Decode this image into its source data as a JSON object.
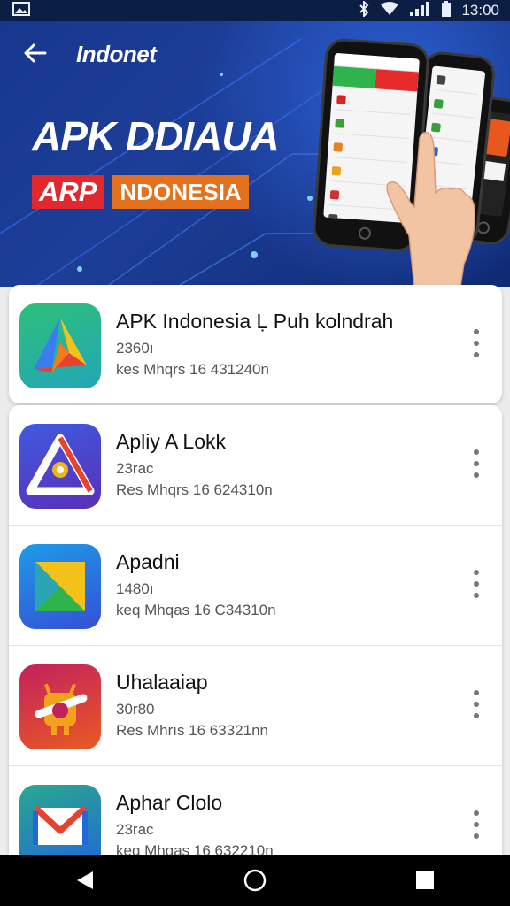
{
  "status_bar": {
    "time": "13:00",
    "icons": [
      "image-icon",
      "bluetooth-icon",
      "wifi-icon",
      "signal-icon",
      "battery-icon"
    ]
  },
  "header": {
    "back_icon": "arrow-left-icon",
    "title": "Indonet",
    "headline": "APK DDIAUA",
    "tag_red": "ARP",
    "tag_orange": "NDONESIA"
  },
  "apps": [
    {
      "name": "APK Indonesia Ḷ Puh kolndrah",
      "version": "2360ı",
      "meta": "kes Mhqrs 16 431240n",
      "icon": "drive-triangle-icon"
    },
    {
      "name": "Apliy A Lokk",
      "version": "23rac",
      "meta": "Res Mhqrs 16 624310n",
      "icon": "triangle-badge-icon"
    },
    {
      "name": "Apadni",
      "version": "1480ı",
      "meta": "keq Mhqas 16 C34310n",
      "icon": "folded-square-icon"
    },
    {
      "name": "Uhalaaiap",
      "version": "30r80",
      "meta": "Res Mhrıs 16 63321nn",
      "icon": "android-robot-icon"
    },
    {
      "name": "Aphar Clolo",
      "version": "23rac",
      "meta": "keq Mhqas 16 632210n",
      "icon": "mail-envelope-icon"
    }
  ],
  "nav": {
    "back": "back-triangle-icon",
    "home": "home-circle-icon",
    "recent": "recent-square-icon"
  },
  "colors": {
    "banner": "#1b3a92",
    "tag_red": "#e0282e",
    "tag_orange": "#e4711e",
    "nav_bg": "#000000"
  }
}
